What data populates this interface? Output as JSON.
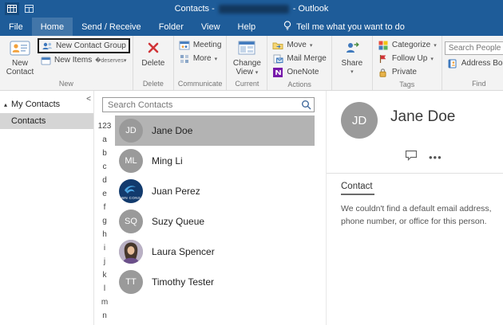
{
  "titlebar": {
    "title_prefix": "Contacts -",
    "title_suffix": "- Outlook"
  },
  "tabs": {
    "file": "File",
    "items": [
      "Home",
      "Send / Receive",
      "Folder",
      "View",
      "Help"
    ],
    "tell_me": "Tell me what you want to do"
  },
  "ribbon": {
    "new_contact": [
      "New",
      "Contact"
    ],
    "new_contact_group": "New Contact Group",
    "new_items": "New Items",
    "delete": "Delete",
    "meeting": "Meeting",
    "more": "More",
    "change_view": [
      "Change",
      "View"
    ],
    "move": "Move",
    "mail_merge": "Mail Merge",
    "onenote": "OneNote",
    "share": "Share",
    "categorize": "Categorize",
    "follow_up": "Follow Up",
    "private": "Private",
    "search_people_placeholder": "Search People",
    "address_book": "Address Book",
    "groups": {
      "new": "New",
      "delete": "Delete",
      "communicate": "Communicate",
      "current_view": "Current View",
      "actions": "Actions",
      "tags": "Tags",
      "find": "Find"
    }
  },
  "sidebar": {
    "header": "My Contacts",
    "items": [
      {
        "label": "Contacts",
        "selected": true
      }
    ]
  },
  "contacts": {
    "search_placeholder": "Search Contacts",
    "alphabet": [
      "123",
      "a",
      "b",
      "c",
      "d",
      "e",
      "f",
      "g",
      "h",
      "i",
      "j",
      "k",
      "l",
      "m",
      "n"
    ],
    "list": [
      {
        "name": "Jane Doe",
        "initials": "JD",
        "selected": true
      },
      {
        "name": "Ming Li",
        "initials": "ML"
      },
      {
        "name": "Juan Perez",
        "logo_text": "WN CONS"
      },
      {
        "name": "Suzy Queue",
        "initials": "SQ"
      },
      {
        "name": "Laura Spencer"
      },
      {
        "name": "Timothy Tester",
        "initials": "TT"
      }
    ]
  },
  "detail": {
    "initials": "JD",
    "name": "Jane Doe",
    "more_button": "•••",
    "section_label": "Contact",
    "empty_message": "We couldn't find a default email address, phone number, or office for this person."
  }
}
